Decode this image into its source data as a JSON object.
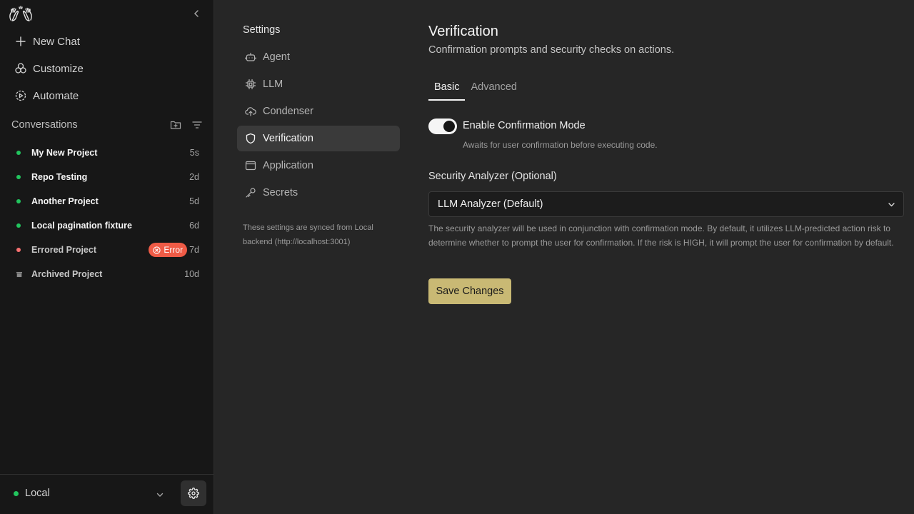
{
  "sidebar": {
    "nav": [
      {
        "label": "New Chat",
        "icon": "plus-icon"
      },
      {
        "label": "Customize",
        "icon": "customize-icon"
      },
      {
        "label": "Automate",
        "icon": "automate-icon"
      }
    ],
    "conversations_title": "Conversations",
    "conversations": [
      {
        "name": "My New Project",
        "time": "5s",
        "status": "green"
      },
      {
        "name": "Repo Testing",
        "time": "2d",
        "status": "green"
      },
      {
        "name": "Another Project",
        "time": "5d",
        "status": "green"
      },
      {
        "name": "Local pagination fixture",
        "time": "6d",
        "status": "green"
      },
      {
        "name": "Errored Project",
        "time": "7d",
        "status": "error",
        "badge": "Error"
      },
      {
        "name": "Archived Project",
        "time": "10d",
        "status": "archived"
      }
    ],
    "backend_label": "Local"
  },
  "settings_nav": {
    "title": "Settings",
    "items": [
      {
        "label": "Agent",
        "icon": "robot-icon"
      },
      {
        "label": "LLM",
        "icon": "chip-icon"
      },
      {
        "label": "Condenser",
        "icon": "cloud-upload-icon"
      },
      {
        "label": "Verification",
        "icon": "shield-icon",
        "active": true
      },
      {
        "label": "Application",
        "icon": "window-icon"
      },
      {
        "label": "Secrets",
        "icon": "key-icon"
      }
    ],
    "sync_note": "These settings are synced from Local backend (http://localhost:3001)"
  },
  "content": {
    "title": "Verification",
    "subtitle": "Confirmation prompts and security checks on actions.",
    "tabs": [
      {
        "label": "Basic",
        "active": true
      },
      {
        "label": "Advanced",
        "active": false
      }
    ],
    "confirmation_toggle": {
      "label": "Enable Confirmation Mode",
      "help": "Awaits for user confirmation before executing code.",
      "enabled": true
    },
    "security_analyzer": {
      "label": "Security Analyzer (Optional)",
      "value": "LLM Analyzer (Default)",
      "help": "The security analyzer will be used in conjunction with confirmation mode. By default, it utilizes LLM-predicted action risk to determine whether to prompt the user for confirmation. If the risk is HIGH, it will prompt the user for confirmation by default."
    },
    "save_label": "Save Changes"
  },
  "colors": {
    "accent": "#c9b974",
    "status_green": "#22c55e",
    "error": "#ef5b46"
  }
}
